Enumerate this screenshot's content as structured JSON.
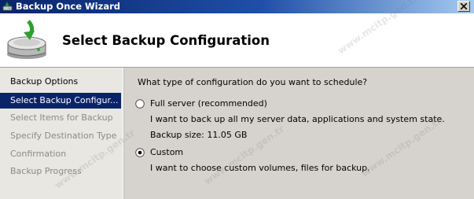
{
  "window": {
    "title": "Backup Once Wizard"
  },
  "header": {
    "title": "Select Backup Configuration"
  },
  "nav": {
    "items": [
      {
        "label": "Backup Options",
        "state": "done"
      },
      {
        "label": "Select Backup Configur...",
        "state": "selected"
      },
      {
        "label": "Select Items for Backup",
        "state": "future"
      },
      {
        "label": "Specify Destination Type",
        "state": "future"
      },
      {
        "label": "Confirmation",
        "state": "future"
      },
      {
        "label": "Backup Progress",
        "state": "future"
      }
    ]
  },
  "content": {
    "question": "What type of configuration do you want to schedule?",
    "options": [
      {
        "label": "Full server (recommended)",
        "description": "I want to back up all my server data, applications and system state.",
        "checked": false
      },
      {
        "label": "Custom",
        "description": "I want to choose custom volumes, files for backup.",
        "checked": true
      }
    ],
    "backup_size": "Backup size: 11.05 GB"
  },
  "watermark": {
    "text": "www.mcitp.gen.tr"
  },
  "colors": {
    "selection": "#0a246a",
    "title_start": "#0a246a",
    "title_end": "#a6caf0",
    "content_bg": "#d6d3ce"
  }
}
